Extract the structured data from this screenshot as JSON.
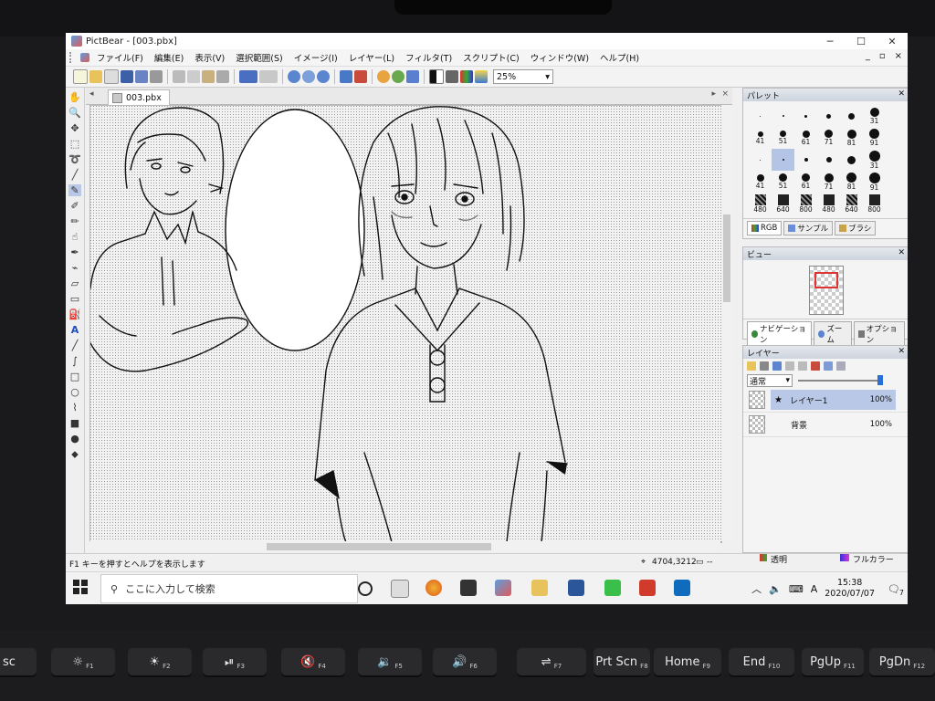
{
  "window": {
    "title": "PictBear - [003.pbx]",
    "controls": {
      "minimize": "─",
      "maximize": "☐",
      "close": "✕"
    }
  },
  "menu": [
    "ファイル(F)",
    "編集(E)",
    "表示(V)",
    "選択範囲(S)",
    "イメージ(I)",
    "レイヤー(L)",
    "フィルタ(T)",
    "スクリプト(C)",
    "ウィンドウ(W)",
    "ヘルプ(H)"
  ],
  "mdi_controls": {
    "minimize": "_",
    "restore": "▫",
    "close": "×"
  },
  "toolbar": {
    "zoom": "25%"
  },
  "document": {
    "tab": "003.pbx"
  },
  "palette": {
    "title": "パレット",
    "brushes": [
      {
        "size": 1,
        "label": ""
      },
      {
        "size": 2,
        "label": ""
      },
      {
        "size": 3,
        "label": ""
      },
      {
        "size": 5,
        "label": ""
      },
      {
        "size": 7,
        "label": ""
      },
      {
        "size": 10,
        "label": "31"
      },
      {
        "size": 6,
        "label": "41"
      },
      {
        "size": 7,
        "label": "51"
      },
      {
        "size": 8,
        "label": "61"
      },
      {
        "size": 9,
        "label": "71"
      },
      {
        "size": 10,
        "label": "81"
      },
      {
        "size": 11,
        "label": "91"
      },
      {
        "size": 1,
        "label": ""
      },
      {
        "size": 2,
        "label": ""
      },
      {
        "size": 4,
        "label": ""
      },
      {
        "size": 6,
        "label": ""
      },
      {
        "size": 9,
        "label": ""
      },
      {
        "size": 12,
        "label": "31"
      },
      {
        "size": 8,
        "label": "41"
      },
      {
        "size": 9,
        "label": "51"
      },
      {
        "size": 9,
        "label": "61"
      },
      {
        "size": 10,
        "label": "71"
      },
      {
        "size": 11,
        "label": "81"
      },
      {
        "size": 12,
        "label": "91"
      },
      {
        "size": 12,
        "label": "480"
      },
      {
        "size": 12,
        "label": "640"
      },
      {
        "size": 12,
        "label": "800"
      },
      {
        "size": 12,
        "label": "480"
      },
      {
        "size": 12,
        "label": "640"
      },
      {
        "size": 12,
        "label": "800"
      }
    ],
    "tabs": [
      "RGB",
      "サンプル",
      "ブラシ"
    ]
  },
  "view": {
    "title": "ビュー",
    "tabs": [
      "ナビゲーション",
      "ズーム",
      "オプション"
    ]
  },
  "layers": {
    "title": "レイヤー",
    "blend_mode": "通常",
    "opacity_fraction": 1.0,
    "items": [
      {
        "name": "レイヤー1",
        "opacity": "100%"
      },
      {
        "name": "背景",
        "opacity": "100%"
      }
    ]
  },
  "status": {
    "help": "F1 キーを押すとヘルプを表示します",
    "coords": "4704,3212",
    "extra": "--",
    "transparency": "透明",
    "colormode": "フルカラー"
  },
  "taskbar": {
    "search_placeholder": "ここに入力して検索",
    "time": "15:38",
    "date": "2020/07/07",
    "ime": "A",
    "notifications": "7"
  },
  "keyboard": [
    {
      "label": "sc",
      "fn": ""
    },
    {
      "label": "☼",
      "fn": "F1"
    },
    {
      "label": "☀",
      "fn": "F2"
    },
    {
      "label": "⏯",
      "fn": "F3"
    },
    {
      "label": "🔇",
      "fn": "F4"
    },
    {
      "label": "🔉",
      "fn": "F5"
    },
    {
      "label": "🔊",
      "fn": "F6"
    },
    {
      "label": "⇌",
      "fn": "F7"
    },
    {
      "label": "Prt Scn",
      "fn": "F8"
    },
    {
      "label": "Home",
      "fn": "F9"
    },
    {
      "label": "End",
      "fn": "F10"
    },
    {
      "label": "PgUp",
      "fn": "F11"
    },
    {
      "label": "PgDn",
      "fn": "F12"
    }
  ]
}
